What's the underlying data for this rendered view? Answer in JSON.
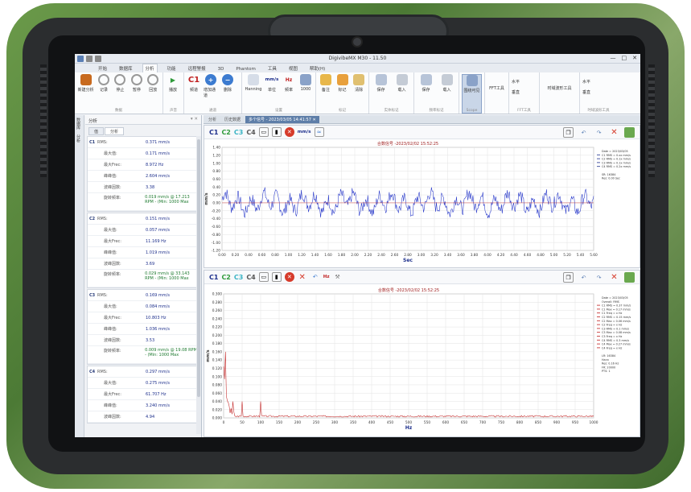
{
  "window": {
    "title": "DigivibeMX M30 - 11.50",
    "controls": [
      "—",
      "□",
      "✕"
    ]
  },
  "ribbon": {
    "tabs": [
      "开始",
      "数据库",
      "分析",
      "功能",
      "远程警报",
      "3D",
      "Phantom",
      "工具",
      "视图",
      "帮助(H)"
    ],
    "active_tab": "分析",
    "groups": [
      {
        "label": "数据",
        "buttons": [
          "新建分析",
          "记录",
          "停止",
          "暂停",
          "回放"
        ]
      },
      {
        "label": "声音",
        "buttons": [
          "播放"
        ]
      },
      {
        "label": "通道",
        "buttons": [
          "C1",
          "增加通道",
          "删除"
        ]
      },
      {
        "label": "设置",
        "buttons": [
          "Hanning",
          "单位",
          "频率",
          "1000"
        ]
      },
      {
        "label": "标记",
        "buttons": [
          "备注",
          "标记",
          "清除"
        ]
      },
      {
        "label": "实体标记",
        "buttons": [
          "保存",
          "载入"
        ]
      },
      {
        "label": "频率标记",
        "buttons": [
          "保存",
          "载入"
        ]
      },
      {
        "label": "Scope",
        "buttons": [
          "围绕可见"
        ]
      },
      {
        "label": "",
        "buttons": [
          "FFT工具"
        ]
      },
      {
        "label": "FFT工具",
        "buttons": [
          "水平",
          "垂直"
        ]
      },
      {
        "label": "",
        "buttons": [
          "时域波形工具"
        ]
      },
      {
        "label": "时域波形工具",
        "buttons": [
          "水平",
          "垂直"
        ]
      }
    ]
  },
  "left_panel": {
    "vertical_tabs": [
      "数据库",
      "分析"
    ],
    "title": "分析",
    "pin": "▾ ✕",
    "tabs": [
      "值",
      "分析"
    ],
    "channels": [
      {
        "ch": "C1",
        "rows": [
          [
            "RMS:",
            "0.371 mm/s"
          ],
          [
            "最大值:",
            "0.171 mm/s"
          ],
          [
            "最大Frec:",
            "8.972 Hz"
          ],
          [
            "峰峰值:",
            "2.604 mm/s"
          ],
          [
            "波峰因数:",
            "3.38"
          ]
        ],
        "rpm_label": "旋转频率:",
        "rpm": "0.019 mm/s @ 17.213 RPM - (Min: 1000 Max"
      },
      {
        "ch": "C2",
        "rows": [
          [
            "RMS:",
            "0.151 mm/s"
          ],
          [
            "最大值:",
            "0.057 mm/s"
          ],
          [
            "最大Frec:",
            "11.169 Hz"
          ],
          [
            "峰峰值:",
            "1.019 mm/s"
          ],
          [
            "波峰因数:",
            "3.69"
          ]
        ],
        "rpm_label": "旋转频率:",
        "rpm": "0.029 mm/s @ 33.143 RPM - (Min: 1000 Max"
      },
      {
        "ch": "C3",
        "rows": [
          [
            "RMS:",
            "0.169 mm/s"
          ],
          [
            "最大值:",
            "0.084 mm/s"
          ],
          [
            "最大Frec:",
            "10.803 Hz"
          ],
          [
            "峰峰值:",
            "1.036 mm/s"
          ],
          [
            "波峰因数:",
            "3.53"
          ]
        ],
        "rpm_label": "旋转频率:",
        "rpm": "0.009 mm/s @ 19.08 RPM - (Min: 1000 Max"
      },
      {
        "ch": "C4",
        "rows": [
          [
            "RMS:",
            "0.297 mm/s"
          ],
          [
            "最大值:",
            "0.275 mm/s"
          ],
          [
            "最大Frec:",
            "61.707 Hz"
          ],
          [
            "峰峰值:",
            "3.240 mm/s"
          ],
          [
            "波峰因数:",
            "4.94"
          ]
        ],
        "rpm_label": "",
        "rpm": ""
      }
    ]
  },
  "doc_tabs": [
    "分析",
    "历史数据",
    "多个信号 - 2023/03/05 14:41:57 ✕"
  ],
  "active_doc_tab": 2,
  "channels": [
    "C1",
    "C2",
    "C3",
    "C4"
  ],
  "channel_colors": {
    "C1": "#1d2f8c",
    "C2": "#2e9a3a",
    "C3": "#39b3c4",
    "C4": "#555555"
  },
  "unit_selector": "mm/s",
  "hz_selector": "Hz",
  "charts": {
    "time": {
      "title": "合数信号 -2023/02/02 15:52:25",
      "xlabel": "Sec",
      "ylabel": "mm/s",
      "y_ticks": [
        "1.40",
        "1.20",
        "1.00",
        "0.80",
        "0.60",
        "0.40",
        "0.20",
        "0.00",
        "-0.20",
        "-0.40",
        "-0.60",
        "-0.80",
        "-1.00",
        "-1.20"
      ],
      "x_ticks": [
        "0.00",
        "0.20",
        "0.40",
        "0.60",
        "0.80",
        "1.00",
        "1.20",
        "1.40",
        "1.60",
        "1.80",
        "2.00",
        "2.20",
        "2.40",
        "2.60",
        "2.80",
        "3.00",
        "3.20",
        "3.40",
        "3.60",
        "3.80",
        "4.00",
        "4.20",
        "4.40",
        "4.60",
        "4.80",
        "5.00",
        "5.20",
        "5.40",
        "5.60"
      ],
      "legend": [
        "Date = 2023/03/05",
        "C1 RMS = 0.xx mm/s",
        "C2 RMS = 0.1x mm/s",
        "C3 RMS = 0.1x mm/s",
        "C4 RMS = 0.2x mm/s",
        "",
        "SR: 16384",
        "Res: 0.00 Sec"
      ]
    },
    "freq": {
      "title": "合数信号 -2023/02/02 15:52:25",
      "xlabel": "Hz",
      "ylabel": "mm/s",
      "y_ticks": [
        "0.300",
        "0.280",
        "0.260",
        "0.240",
        "0.220",
        "0.200",
        "0.180",
        "0.160",
        "0.140",
        "0.120",
        "0.100",
        "0.080",
        "0.060",
        "0.040",
        "0.020",
        "0.000"
      ],
      "x_ticks": [
        "0",
        "50",
        "100",
        "150",
        "200",
        "250",
        "300",
        "350",
        "400",
        "450",
        "500",
        "550",
        "600",
        "650",
        "700",
        "750",
        "800",
        "850",
        "900",
        "950",
        "1000"
      ],
      "legend": [
        "Date = 2023/03/05",
        "Overall: RMS",
        "C1 RMS = 0.37 mm/s",
        "C1 Max = 0.17 mm/s",
        "C1 Freq = x Hz",
        "C2 RMS = 0.15 mm/s",
        "C2 Max = 0.06 mm/s",
        "C2 Freq = x Hz",
        "C3 RMS = 0.1 mm/s",
        "C3 Max = 0.08 mm/s",
        "C3 Freq = x Hz",
        "C4 RMS = 0.3 mm/s",
        "C4 Max = 0.27 mm/s",
        "C4 Freq = x Hz",
        "",
        "LR: 16384",
        "Hann",
        "Res: 0.16 Hz",
        "FR: 20000",
        "PTS: 1"
      ]
    }
  }
}
